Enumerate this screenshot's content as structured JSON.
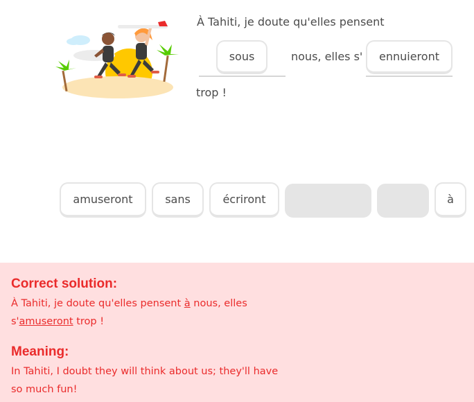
{
  "prompt": {
    "part1": "À Tahiti, je doute qu'elles pensent",
    "part2": "nous, elles s'",
    "part3": "trop !"
  },
  "blanks": [
    "sous",
    "ennuieront"
  ],
  "word_bank": [
    "amuseront",
    "sans",
    "écriront",
    "",
    "",
    "à"
  ],
  "feedback": {
    "solution_heading": "Correct solution:",
    "solution_parts": [
      "À Tahiti, je doute qu'elles pensent ",
      "à",
      " nous, elles",
      "s'",
      "amuseront",
      " trop !"
    ],
    "meaning_heading": "Meaning:",
    "meaning_text": "In Tahiti, I doubt they will think about us; they'll have so much fun!"
  },
  "colors": {
    "error_text": "#ea2b2b",
    "error_bg": "#ffdfe0",
    "chip_border": "#e5e5e5"
  }
}
